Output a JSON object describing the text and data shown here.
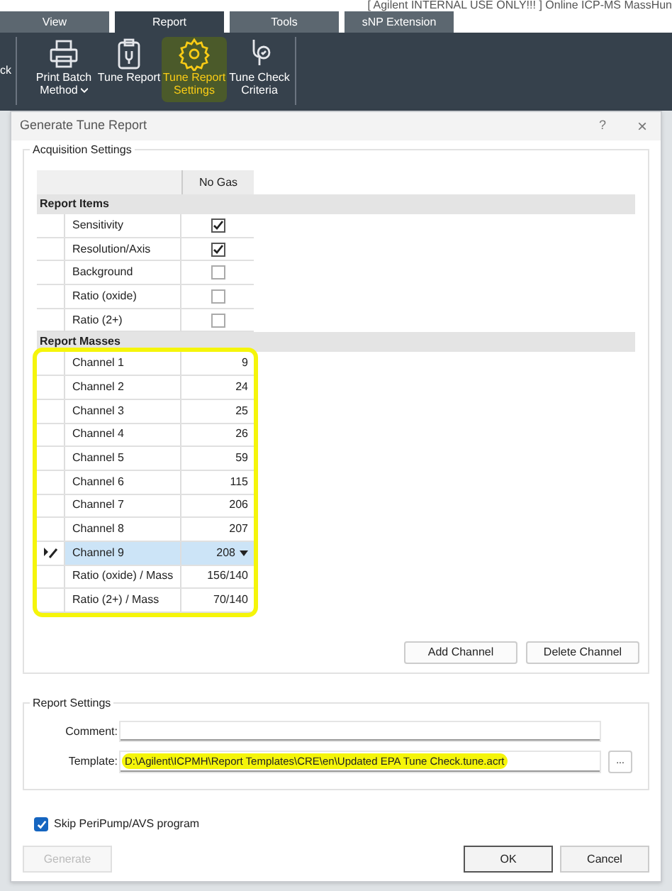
{
  "app_title": "[ Agilent INTERNAL USE ONLY!!! ] Online ICP-MS MassHun",
  "tabs": [
    {
      "label": "View",
      "selected": false
    },
    {
      "label": "Report",
      "selected": true
    },
    {
      "label": "Tools",
      "selected": false
    },
    {
      "label": "sNP Extension",
      "selected": false
    }
  ],
  "ribbon": [
    {
      "kind": "cut",
      "label": "ck"
    },
    {
      "kind": "printer",
      "label": "Print Batch Method",
      "dropdown": true,
      "highlighted": false
    },
    {
      "kind": "clipboard",
      "label": "Tune Report",
      "dropdown": false,
      "highlighted": false
    },
    {
      "kind": "gear",
      "label": "Tune Report Settings",
      "dropdown": false,
      "highlighted": true
    },
    {
      "kind": "stethoscope",
      "label": "Tune Check Criteria",
      "dropdown": false,
      "highlighted": false
    }
  ],
  "dialog": {
    "title": "Generate Tune Report",
    "help": "?",
    "close": "×"
  },
  "acquisition": {
    "title": "Acquisition Settings",
    "column": "No Gas",
    "sections": [
      {
        "title": "Report Items",
        "highlighted": false,
        "rows": [
          {
            "kind": "check",
            "name": "Sensitivity",
            "checked": true
          },
          {
            "kind": "check",
            "name": "Resolution/Axis",
            "checked": true
          },
          {
            "kind": "check",
            "name": "Background",
            "checked": false
          },
          {
            "kind": "check",
            "name": "Ratio (oxide)",
            "checked": false
          },
          {
            "kind": "check",
            "name": "Ratio (2+)",
            "checked": false
          }
        ]
      },
      {
        "title": "Report Masses",
        "highlighted": true,
        "rows": [
          {
            "kind": "value",
            "name": "Channel 1",
            "value": "9",
            "selected": false
          },
          {
            "kind": "value",
            "name": "Channel 2",
            "value": "24",
            "selected": false
          },
          {
            "kind": "value",
            "name": "Channel 3",
            "value": "25",
            "selected": false
          },
          {
            "kind": "value",
            "name": "Channel 4",
            "value": "26",
            "selected": false
          },
          {
            "kind": "value",
            "name": "Channel 5",
            "value": "59",
            "selected": false
          },
          {
            "kind": "value",
            "name": "Channel 6",
            "value": "115",
            "selected": false
          },
          {
            "kind": "value",
            "name": "Channel 7",
            "value": "206",
            "selected": false
          },
          {
            "kind": "value",
            "name": "Channel 8",
            "value": "207",
            "selected": false
          },
          {
            "kind": "value",
            "name": "Channel 9",
            "value": "208",
            "selected": true
          },
          {
            "kind": "value",
            "name": "Ratio (oxide) / Mass",
            "value": "156/140",
            "selected": false
          },
          {
            "kind": "value",
            "name": "Ratio (2+) / Mass",
            "value": "70/140",
            "selected": false
          }
        ]
      }
    ],
    "buttons": [
      "Add Channel",
      "Delete Channel"
    ]
  },
  "report_settings": {
    "title": "Report Settings",
    "comment": {
      "label": "Comment:"
    },
    "template": {
      "label": "Template:",
      "value": "D:\\Agilent\\ICPMH\\Report Templates\\CRE\\en\\Updated EPA Tune Check.tune.acrt",
      "highlighted": true
    },
    "browse": "..."
  },
  "skip": {
    "label": "Skip PeriPump/AVS program",
    "checked": true
  },
  "footer": [
    {
      "label": "Generate",
      "disabled": true,
      "default": false
    },
    {
      "label": "OK",
      "disabled": false,
      "default": true
    },
    {
      "label": "Cancel",
      "disabled": false,
      "default": false
    }
  ]
}
